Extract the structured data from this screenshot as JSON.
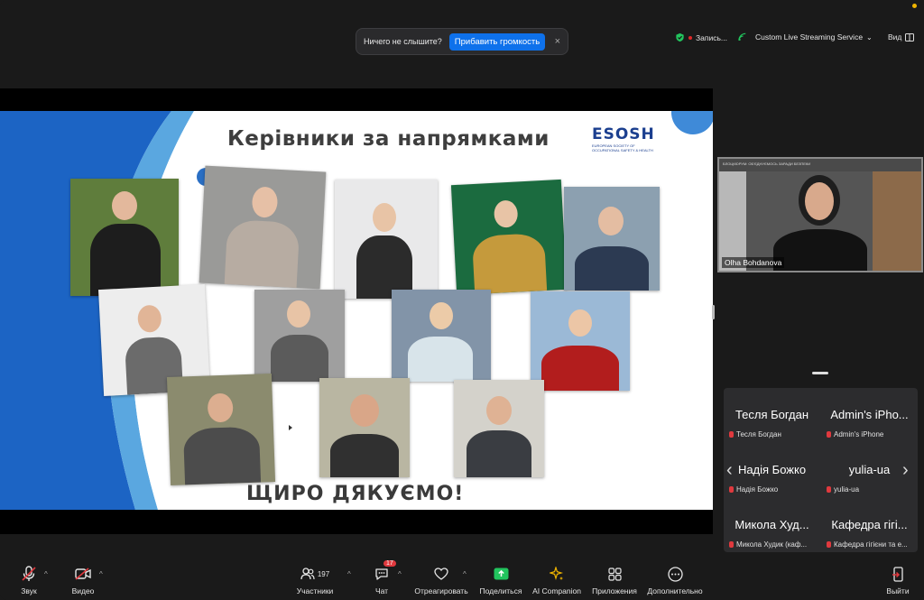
{
  "notice": {
    "text": "Ничего не слышите?",
    "button": "Прибавить громкость"
  },
  "status": {
    "record": "Запись...",
    "stream": "Custom Live Streaming Service",
    "view": "Вид"
  },
  "slide": {
    "title": "Керівники за напрямками",
    "thanks": "ЩИРО ДЯКУЄМО!",
    "logo": {
      "name": "ESOSH",
      "line1": "EUROPEAN SOCIETY OF",
      "line2": "OCCUPATIONAL SAFETY & HEALTH"
    }
  },
  "speaker": {
    "name": "Olha Bohdanova",
    "banner": "БЛОЦКЮРУМ: ОБ'ЄДНУЄМОСЬ ЗАРАДИ БЕЗПЕКИ"
  },
  "gallery": [
    {
      "display": "Тесля Богдан",
      "label": "Тесля Богдан"
    },
    {
      "display": "Admin's iPho...",
      "label": "Admin's iPhone"
    },
    {
      "display": "Надія Божко",
      "label": "Надія Божко"
    },
    {
      "display": "yulia-ua",
      "label": "yulia-ua"
    },
    {
      "display": "Микола Худ...",
      "label": "Микола Худик (каф..."
    },
    {
      "display": "Кафедра гігі...",
      "label": "Кафедра гігієни та е..."
    }
  ],
  "toolbar": {
    "audio": "Звук",
    "video": "Видео",
    "participants": "Участники",
    "participants_count": "197",
    "chat": "Чат",
    "chat_badge": "17",
    "react": "Отреагировать",
    "share": "Поделиться",
    "ai": "AI Companion",
    "apps": "Приложения",
    "more": "Дополнительно",
    "leave": "Выйти"
  },
  "colors": {
    "accent": "#0e71eb",
    "share_green": "#22c55e",
    "alert": "#e0393e",
    "brand_blue": "#1b3f8f"
  }
}
